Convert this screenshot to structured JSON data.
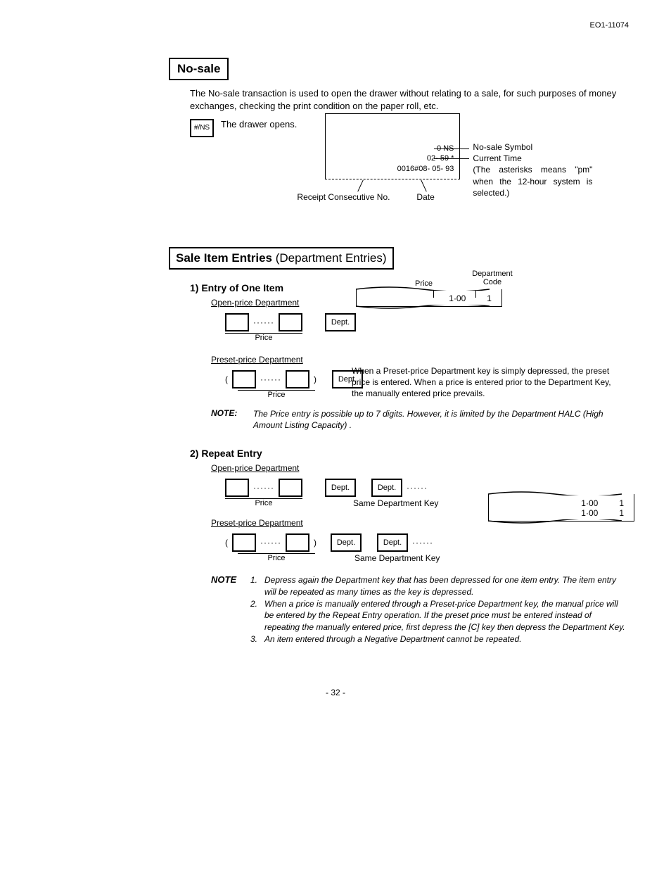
{
  "doc_code": "EO1-11074",
  "no_sale": {
    "heading": "No-sale",
    "description": "The No-sale transaction is used to open the drawer without relating to a sale, for such purposes of money exchanges, checking the print condition on the paper roll, etc.",
    "key_label": "#/NS",
    "drawer_opens": "The drawer opens.",
    "receipt_lines": {
      "l1": "0    NS",
      "l2": "02- 59   *",
      "l3": "0016#08- 05- 93"
    },
    "annot_ns_symbol": "No-sale Symbol",
    "annot_time": "Current Time",
    "annot_time_detail": "(The asterisks means \"pm\" when the 12-hour system is selected.)",
    "annot_receipt_no": "Receipt Consecutive No.",
    "annot_date": "Date"
  },
  "sale_item": {
    "heading_bold": "Sale Item Entries",
    "heading_rest": " (Department Entries)",
    "entry1_title": "1)  Entry of One Item",
    "open_price_dept": "Open-price Department",
    "preset_price_dept": "Preset-price Department",
    "price_label": "Price",
    "dept_key": "Dept.",
    "paren_open": "(",
    "paren_close": ")",
    "dots": "······",
    "dept_code_label": "Department Code",
    "price_col": "Price",
    "receipt1_price": "1·00",
    "receipt1_code": "1",
    "preset_desc": "When a Preset-price Department key is simply depressed, the preset price is entered. When a price is entered prior to the Department Key, the manually entered price prevails.",
    "note_label": "NOTE:",
    "note_text": "The Price entry is possible up to 7 digits. However, it is limited by the Department HALC (High Amount Listing Capacity) .",
    "entry2_title": "2)  Repeat Entry",
    "same_dept_key": "Same Department Key",
    "receipt2a_price": "1·00",
    "receipt2a_code": "1",
    "receipt2b_price": "1·00",
    "receipt2b_code": "1",
    "note2_label": "NOTE",
    "note2_1": "Depress again the Department key that has been depressed for one item entry. The item entry will be repeated as many times as the key is depressed.",
    "note2_2": "When a price is manually entered through a Preset-price Department key, the manual price will be entered by the Repeat Entry operation. If the preset price must be entered instead of repeating the manually entered price, first depress the [C] key then depress the Department Key.",
    "note2_3": "An item entered through a Negative Department cannot be repeated.",
    "n1": "1.",
    "n2": "2.",
    "n3": "3."
  },
  "footer": "- 32 -"
}
